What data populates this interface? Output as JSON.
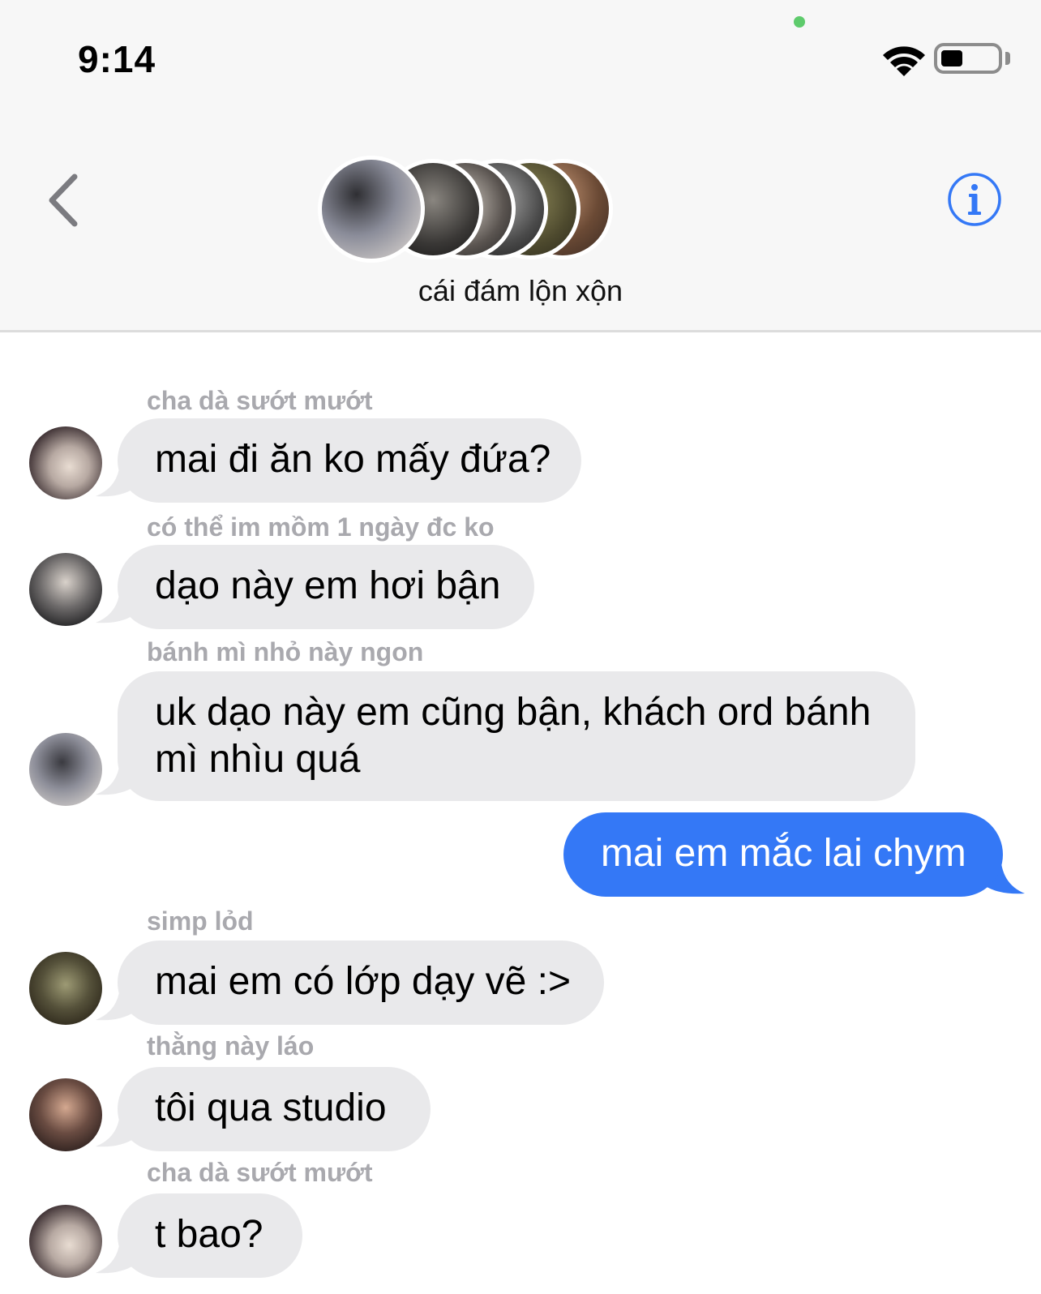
{
  "status_bar": {
    "time": "9:14"
  },
  "header": {
    "group_name": "cái đám lộn xộn"
  },
  "messages": [
    {
      "sender": "cha dà sướt mướt",
      "text": "mai đi ăn ko mấy đứa?",
      "direction": "incoming"
    },
    {
      "sender": "có thể im mồm 1 ngày đc ko",
      "text": "dạo này em hơi bận",
      "direction": "incoming"
    },
    {
      "sender": "bánh mì nhỏ này ngon",
      "text_line1": "uk dạo này em cũng bận, khách ord bánh",
      "text_line2": "mì nhìu quá",
      "direction": "incoming"
    },
    {
      "text": "mai em mắc lai chym",
      "direction": "outgoing"
    },
    {
      "sender": "simp lỏd",
      "text": "mai em có lớp dạy vẽ :>",
      "direction": "incoming"
    },
    {
      "sender": "thằng này láo",
      "text": "tôi qua studio",
      "direction": "incoming"
    },
    {
      "sender": "cha dà sướt mướt",
      "text": "t bao?",
      "direction": "incoming"
    }
  ],
  "colors": {
    "incoming_bubble": "#e9e9eb",
    "outgoing_bubble": "#3478f6",
    "sender_label": "#a9a9ae",
    "accent": "#3478f6"
  },
  "icons": [
    "wifi-icon",
    "battery-icon",
    "back-chevron-icon",
    "info-icon"
  ]
}
